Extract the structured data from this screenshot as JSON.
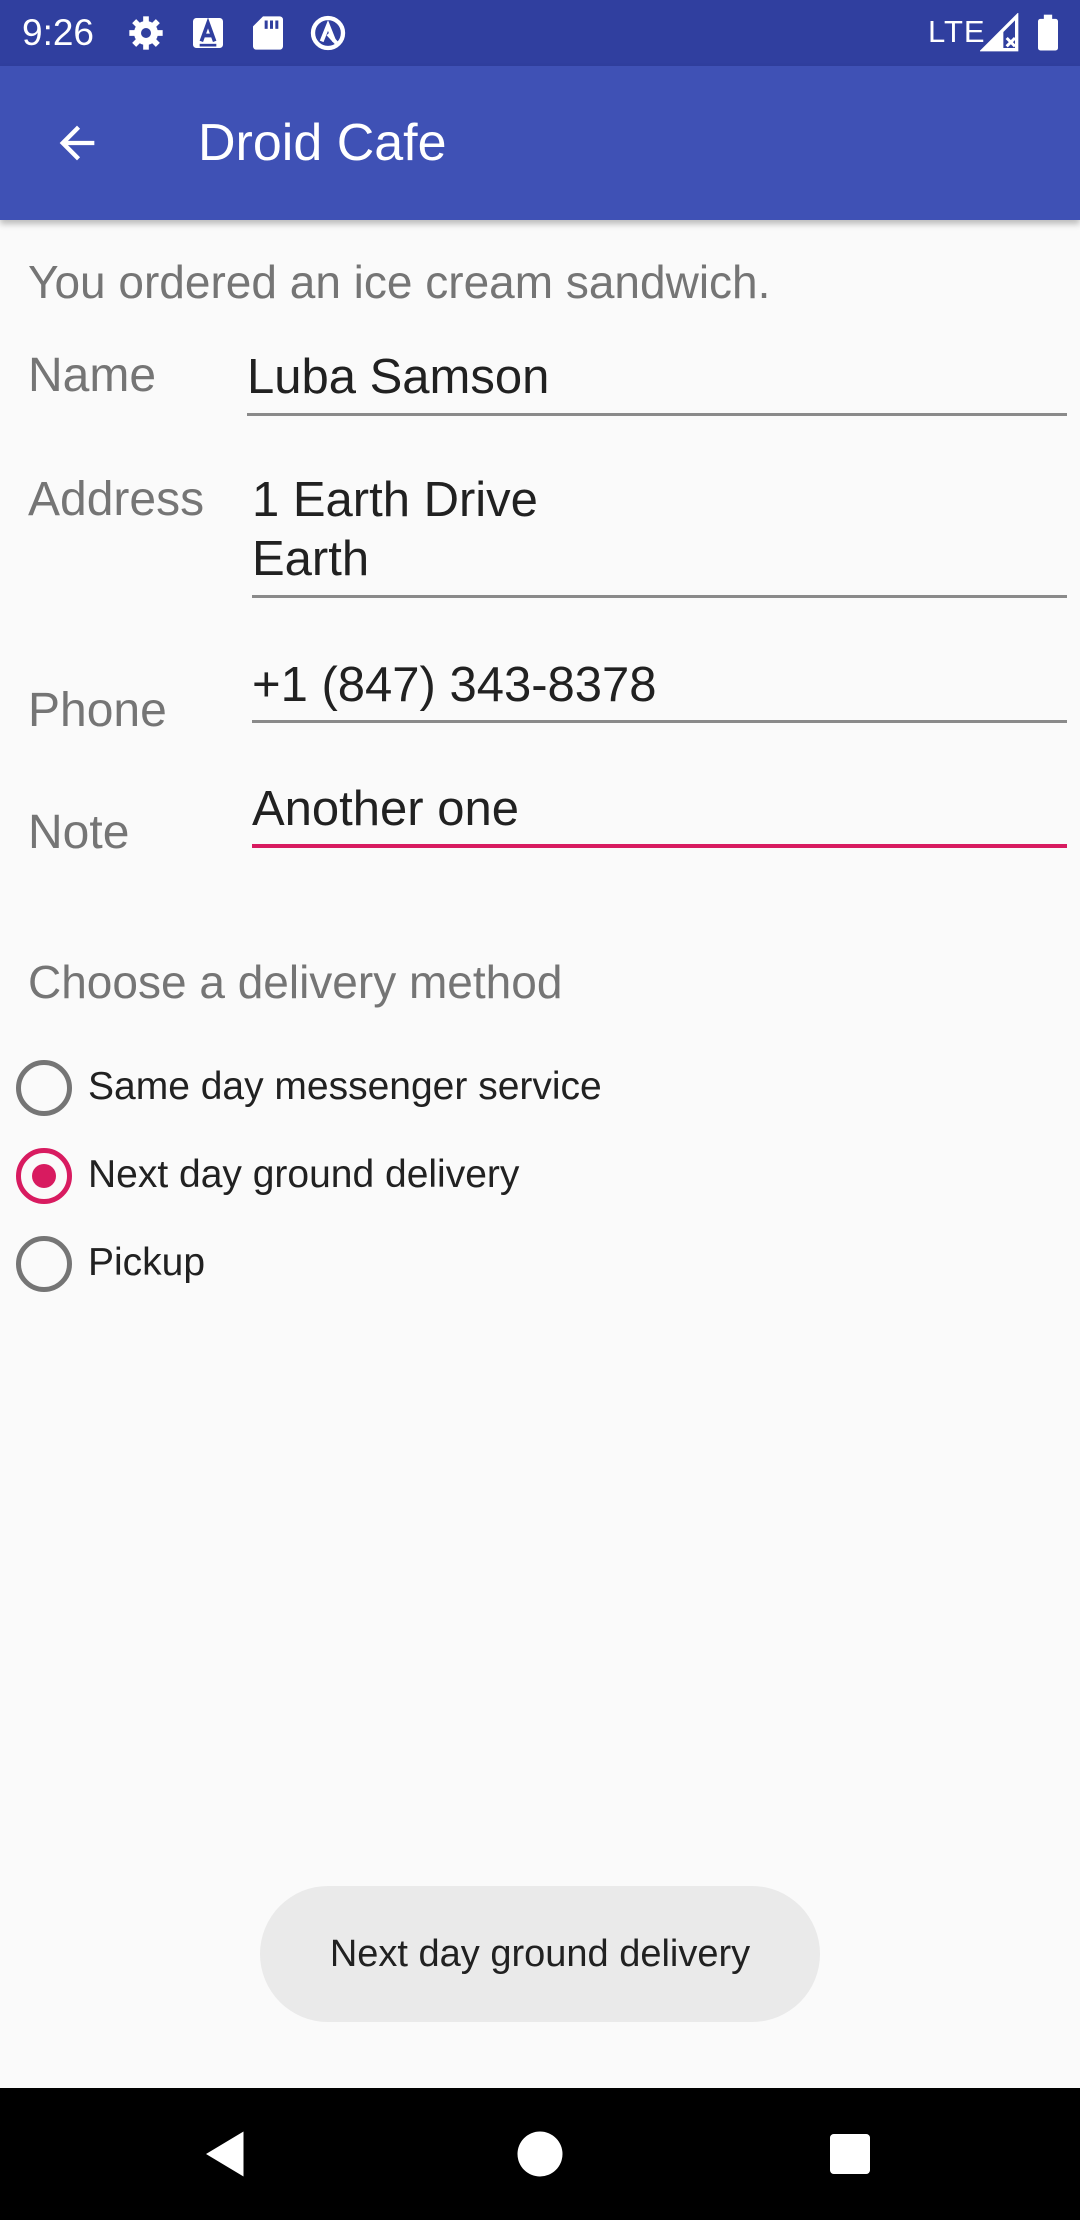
{
  "status_bar": {
    "time": "9:26",
    "network": "LTE",
    "icons": [
      "gear-icon",
      "a-box-icon",
      "sd-card-icon",
      "circle-a-icon",
      "signal-icon",
      "battery-icon"
    ]
  },
  "app_bar": {
    "title": "Droid Cafe",
    "back_icon": "arrow-left-icon"
  },
  "order": {
    "message": "You ordered an ice cream sandwich."
  },
  "form": {
    "name": {
      "label": "Name",
      "value": "Luba Samson"
    },
    "address": {
      "label": "Address",
      "value": "1 Earth Drive\nEarth"
    },
    "phone": {
      "label": "Phone",
      "value": "+1 (847) 343-8378"
    },
    "note": {
      "label": "Note",
      "value": "Another one"
    }
  },
  "delivery": {
    "heading": "Choose a delivery method",
    "options": [
      {
        "label": "Same day messenger service",
        "checked": false
      },
      {
        "label": "Next day ground delivery",
        "checked": true
      },
      {
        "label": "Pickup",
        "checked": false
      }
    ]
  },
  "toast": {
    "text": "Next day ground delivery"
  },
  "nav_bar": {
    "icons": [
      "back-triangle-icon",
      "home-circle-icon",
      "recents-square-icon"
    ]
  },
  "colors": {
    "status_bar": "#303f9f",
    "app_bar": "#3f51b5",
    "accent": "#d81b60",
    "background": "#fafafa"
  }
}
